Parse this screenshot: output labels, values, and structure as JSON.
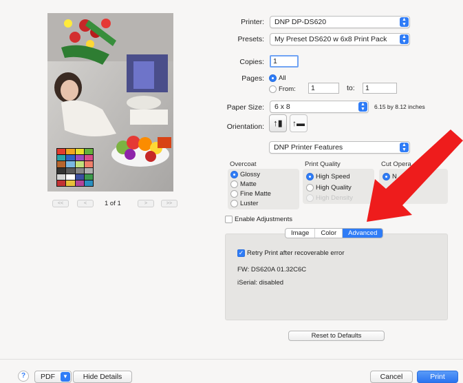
{
  "preview": {
    "page_indicator": "1 of 1",
    "nav": {
      "first": "<<",
      "prev": "<",
      "next": ">",
      "last": ">>"
    },
    "color_chart": [
      "#e23c2e",
      "#f0a51f",
      "#e9df2b",
      "#63b13b",
      "#2aa4a8",
      "#2f62c5",
      "#9a4cc0",
      "#d94b8a",
      "#b5652e",
      "#7ab8e2",
      "#c2e07c",
      "#f07f6a",
      "#333333",
      "#5a5a5a",
      "#888888",
      "#b0b0b0",
      "#d6d6d6",
      "#ffffff",
      "#3b4fa0",
      "#3c9a4d",
      "#c23233",
      "#e8c13b",
      "#b24499",
      "#2a8fbf"
    ]
  },
  "printer": {
    "label": "Printer:",
    "value": "DNP DP-DS620"
  },
  "presets": {
    "label": "Presets:",
    "value": "My Preset DS620 w 6x8 Print Pack"
  },
  "copies": {
    "label": "Copies:",
    "value": "1"
  },
  "pages": {
    "label": "Pages:",
    "all_label": "All",
    "from_label": "From:",
    "from_value": "1",
    "to_label": "to:",
    "to_value": "1"
  },
  "paper_size": {
    "label": "Paper Size:",
    "value": "6 x 8",
    "dimensions": "6.15 by 8.12 inches"
  },
  "orientation": {
    "label": "Orientation:"
  },
  "features_popup": {
    "value": "DNP Printer Features"
  },
  "overcoat": {
    "title": "Overcoat",
    "options": [
      "Glossy",
      "Matte",
      "Fine Matte",
      "Luster"
    ],
    "selected": "Glossy"
  },
  "print_quality": {
    "title": "Print Quality",
    "options": [
      "High Speed",
      "High Quality",
      "High Density"
    ],
    "selected": "High Speed"
  },
  "cut_operation": {
    "title": "Cut Opera",
    "option_partial": "N"
  },
  "enable_adjustments": {
    "label": "Enable Adjustments",
    "checked": false
  },
  "tabs": {
    "items": [
      "Image",
      "Color",
      "Advanced"
    ],
    "selected": "Advanced"
  },
  "advanced": {
    "retry_label": "Retry Print after recoverable error",
    "retry_checked": true,
    "fw": "FW: DS620A 01.32C6C",
    "iserial": "iSerial: disabled"
  },
  "reset_button": "Reset to Defaults",
  "bottom": {
    "help": "?",
    "pdf": "PDF",
    "hide_details": "Hide Details",
    "cancel": "Cancel",
    "print": "Print"
  },
  "colors": {
    "accent": "#2f7cf6",
    "arrow": "#ee1c1c"
  }
}
